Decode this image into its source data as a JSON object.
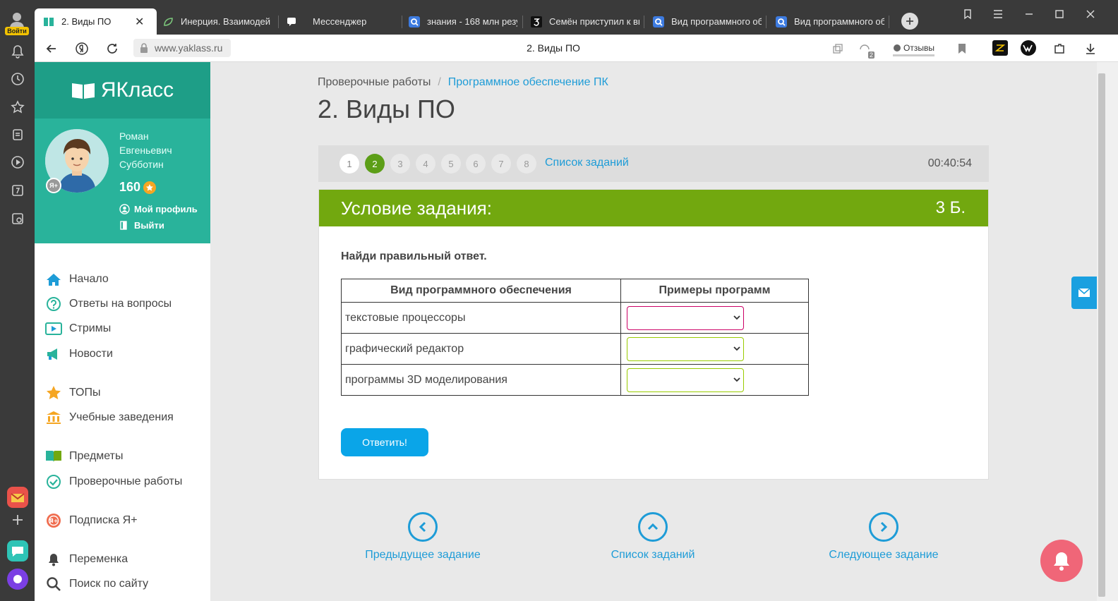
{
  "browser": {
    "tabs": [
      {
        "title": "2. Виды ПО",
        "active": true
      },
      {
        "title": "Инерция. Взаимодей"
      },
      {
        "title": "Мессенджер"
      },
      {
        "title": "знания - 168 млн резу"
      },
      {
        "title": "Семён приступил к вы"
      },
      {
        "title": "Вид программного об"
      },
      {
        "title": "Вид программного об"
      }
    ],
    "url": "www.yaklass.ru",
    "page_title": "2. Виды ПО",
    "feedback_label": "Отзывы",
    "login_label": "Войти",
    "counter_badge": "2"
  },
  "site": {
    "logo": "ЯКласс",
    "user": {
      "name": "Роман Евгеньевич Субботин",
      "points": "160",
      "my_profile": "Мой профиль",
      "logout": "Выйти",
      "badge": "Я+"
    },
    "nav": [
      {
        "label": "Начало",
        "icon": "home-icon"
      },
      {
        "label": "Ответы на вопросы",
        "icon": "question-icon"
      },
      {
        "label": "Стримы",
        "icon": "play-icon"
      },
      {
        "label": "Новости",
        "icon": "megaphone-icon"
      },
      {
        "label": "ТОПы",
        "icon": "star-icon"
      },
      {
        "label": "Учебные заведения",
        "icon": "school-icon"
      },
      {
        "label": "Предметы",
        "icon": "book-icon"
      },
      {
        "label": "Проверочные работы",
        "icon": "check-circle-icon"
      },
      {
        "label": "Подписка Я+",
        "icon": "subscription-icon"
      },
      {
        "label": "Переменка",
        "icon": "bell-icon"
      },
      {
        "label": "Поиск по сайту",
        "icon": "search-icon"
      }
    ]
  },
  "main": {
    "breadcrumb": {
      "root": "Проверочные работы",
      "current": "Программное обеспечение ПК"
    },
    "title": "2. Виды ПО",
    "steps": [
      "1",
      "2",
      "3",
      "4",
      "5",
      "6",
      "7",
      "8"
    ],
    "current_step": "2",
    "task_list_label": "Список заданий",
    "timer": "00:40:54",
    "task": {
      "header": "Условие задания:",
      "score": "3 Б.",
      "question": "Найди правильный ответ.",
      "table": {
        "headers": [
          "Вид программного обеспечения",
          "Примеры программ"
        ],
        "rows": [
          {
            "type": "текстовые процессоры",
            "selected": ""
          },
          {
            "type": "графический редактор",
            "selected": ""
          },
          {
            "type": "программы 3D моделирования",
            "selected": ""
          }
        ]
      },
      "submit_label": "Ответить!"
    },
    "bottom_nav": {
      "prev": "Предыдущее задание",
      "list": "Список заданий",
      "next": "Следующее задание"
    }
  },
  "colors": {
    "brand_green": "#29b39b",
    "task_header": "#72a80f",
    "link_blue": "#1e9cd7",
    "submit_blue": "#0aa5e8",
    "step_current": "#5c9e17"
  }
}
